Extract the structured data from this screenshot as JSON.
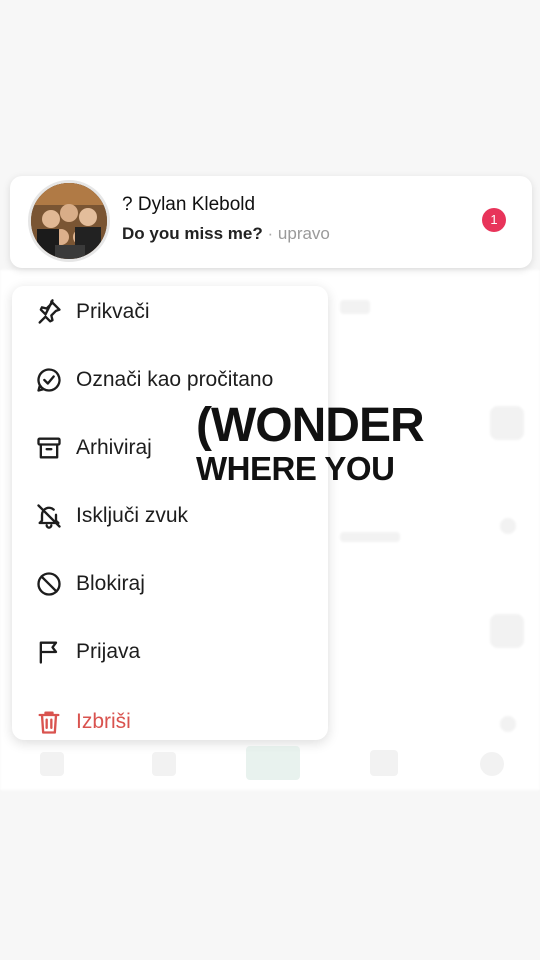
{
  "conversation": {
    "name": "? Dylan Klebold",
    "message": "Do you miss me?",
    "separator": "·",
    "time": "upravo",
    "unread_count": "1"
  },
  "context_menu": {
    "items": [
      {
        "label": "Prikvači",
        "icon": "pin-icon"
      },
      {
        "label": "Označi kao pročitano",
        "icon": "mark-read-icon"
      },
      {
        "label": "Arhiviraj",
        "icon": "archive-icon"
      },
      {
        "label": "Isključi zvuk",
        "icon": "bell-off-icon"
      },
      {
        "label": "Blokiraj",
        "icon": "block-icon"
      },
      {
        "label": "Prijava",
        "icon": "flag-icon"
      },
      {
        "label": "Izbriši",
        "icon": "trash-icon"
      }
    ]
  },
  "overlay_text": {
    "line1": "(WONDER",
    "line2": "WHERE YOU"
  },
  "colors": {
    "badge": "#e8345a",
    "delete": "#d9534f"
  }
}
